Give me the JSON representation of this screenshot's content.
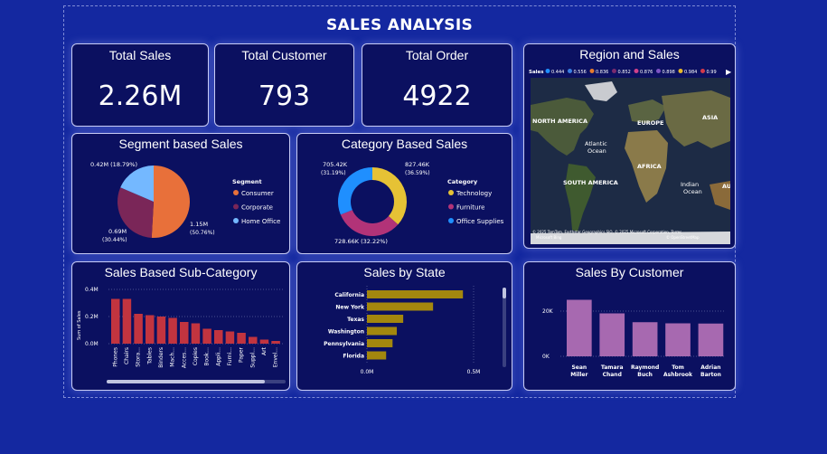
{
  "dashboard": {
    "title": "SALES ANALYSIS"
  },
  "kpis": [
    {
      "label": "Total Sales",
      "value": "2.26M"
    },
    {
      "label": "Total Customer",
      "value": "793"
    },
    {
      "label": "Total Order",
      "value": "4922"
    }
  ],
  "region": {
    "title": "Region and Sales",
    "legend_title": "Sales",
    "legend": [
      {
        "label": "0.444",
        "color": "#1f8fff"
      },
      {
        "label": "0.556",
        "color": "#3a7fe0"
      },
      {
        "label": "0.836",
        "color": "#e57a2e"
      },
      {
        "label": "0.852",
        "color": "#7a2a6e"
      },
      {
        "label": "0.876",
        "color": "#d0418a"
      },
      {
        "label": "0.898",
        "color": "#7d54c4"
      },
      {
        "label": "0.984",
        "color": "#e6b82a"
      },
      {
        "label": "0.99",
        "color": "#d23a4a"
      }
    ],
    "labels": [
      "NORTH AMERICA",
      "EUROPE",
      "ASIA",
      "Atlantic Ocean",
      "AFRICA",
      "SOUTH AMERICA",
      "Indian Ocean",
      "AU"
    ],
    "attribution": "© 2025 TomTom, Earthstar Geographics SIO, © 2025 Microsoft Corporation, Terms",
    "attribution2": "© OpenStreetMap",
    "bing": "Microsoft Bing"
  },
  "colors": {
    "consumer": "#e8703a",
    "corporate": "#7a2658",
    "home_office": "#74b8ff",
    "technology": "#e6c235",
    "furniture": "#b23378",
    "office_supplies": "#1f8fff",
    "subcat_bar": "#c2343f",
    "state_bar": "#a3870e",
    "customer_bar": "#a769b0"
  },
  "chart_data": [
    {
      "type": "pie",
      "title": "Segment based Sales",
      "legend_title": "Segment",
      "slices": [
        {
          "name": "Consumer",
          "value": 1.15,
          "label": "1.15M",
          "pct": "(50.76%)"
        },
        {
          "name": "Corporate",
          "value": 0.69,
          "label": "0.69M",
          "pct": "(30.44%)"
        },
        {
          "name": "Home Office",
          "value": 0.42,
          "label": "0.42M (18.79%)",
          "pct": ""
        }
      ]
    },
    {
      "type": "pie",
      "title": "Category Based Sales",
      "legend_title": "Category",
      "slices": [
        {
          "name": "Technology",
          "value": 827.46,
          "label": "827.46K",
          "pct": "(36.59%)"
        },
        {
          "name": "Furniture",
          "value": 728.66,
          "label": "728.66K (32.22%)",
          "pct": ""
        },
        {
          "name": "Office Supplies",
          "value": 705.42,
          "label": "705.42K",
          "pct": "(31.19%)"
        }
      ]
    },
    {
      "type": "bar",
      "title": "Sales Based Sub-Category",
      "ylabel": "Sum of Sales",
      "yticks": [
        "0.4M",
        "0.2M",
        "0.0M"
      ],
      "ylim": [
        0,
        0.4
      ],
      "categories": [
        "Phones",
        "Chairs",
        "Stora...",
        "Tables",
        "Binders",
        "Mach...",
        "Acces...",
        "Copies",
        "Book...",
        "Appli...",
        "Furni...",
        "Paper",
        "Suppl...",
        "Art",
        "Envel..."
      ],
      "values": [
        0.33,
        0.33,
        0.22,
        0.21,
        0.2,
        0.19,
        0.16,
        0.15,
        0.11,
        0.1,
        0.09,
        0.08,
        0.05,
        0.03,
        0.02
      ]
    },
    {
      "type": "bar",
      "title": "Sales by State",
      "orientation": "horizontal",
      "xticks": [
        "0.0M",
        "0.5M"
      ],
      "xlim": [
        0,
        0.5
      ],
      "categories": [
        "California",
        "New York",
        "Texas",
        "Washington",
        "Pennsylvania",
        "Florida"
      ],
      "values": [
        0.45,
        0.31,
        0.17,
        0.14,
        0.12,
        0.09
      ]
    },
    {
      "type": "bar",
      "title": "Sales By Customer",
      "yticks": [
        "20K",
        "0K"
      ],
      "ylim": [
        0,
        28
      ],
      "categories": [
        [
          "Sean",
          "Miller"
        ],
        [
          "Tamara",
          "Chand"
        ],
        [
          "Raymond",
          "Buch"
        ],
        [
          "Tom",
          "Ashbrook"
        ],
        [
          "Adrian",
          "Barton"
        ]
      ],
      "values": [
        25,
        19,
        15.1,
        14.6,
        14.5
      ]
    }
  ]
}
